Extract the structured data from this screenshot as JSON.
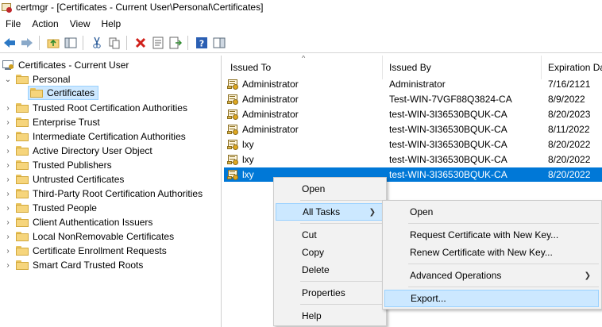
{
  "window": {
    "title": "certmgr - [Certificates - Current User\\Personal\\Certificates]"
  },
  "menu": [
    "File",
    "Action",
    "View",
    "Help"
  ],
  "toolbar": {
    "buttons": [
      "back-icon",
      "forward-icon",
      "up-folder-icon",
      "show-hide-tree-icon",
      "cut-icon",
      "copy-icon",
      "delete-icon",
      "properties-icon",
      "export-list-icon",
      "help-icon",
      "action-pane-icon"
    ]
  },
  "tree": {
    "root": "Certificates - Current User",
    "personal": "Personal",
    "certificates": "Certificates",
    "folders": [
      "Trusted Root Certification Authorities",
      "Enterprise Trust",
      "Intermediate Certification Authorities",
      "Active Directory User Object",
      "Trusted Publishers",
      "Untrusted Certificates",
      "Third-Party Root Certification Authorities",
      "Trusted People",
      "Client Authentication Issuers",
      "Local NonRemovable Certificates",
      "Certificate Enrollment Requests",
      "Smart Card Trusted Roots"
    ]
  },
  "list": {
    "columns": [
      "Issued To",
      "Issued By",
      "Expiration Da"
    ],
    "rows": [
      {
        "issued_to": "Administrator",
        "issued_by": "Administrator",
        "expiration": "7/16/2121"
      },
      {
        "issued_to": "Administrator",
        "issued_by": "Test-WIN-7VGF88Q3824-CA",
        "expiration": "8/9/2022"
      },
      {
        "issued_to": "Administrator",
        "issued_by": "test-WIN-3I36530BQUK-CA",
        "expiration": "8/20/2023"
      },
      {
        "issued_to": "Administrator",
        "issued_by": "test-WIN-3I36530BQUK-CA",
        "expiration": "8/11/2022"
      },
      {
        "issued_to": "lxy",
        "issued_by": "test-WIN-3I36530BQUK-CA",
        "expiration": "8/20/2022"
      },
      {
        "issued_to": "lxy",
        "issued_by": "test-WIN-3I36530BQUK-CA",
        "expiration": "8/20/2022"
      },
      {
        "issued_to": "lxy",
        "issued_by": "test-WIN-3I36530BQUK-CA",
        "expiration": "8/20/2022"
      }
    ],
    "selected_row": 6
  },
  "context_menu": {
    "open": "Open",
    "all_tasks": "All Tasks",
    "cut": "Cut",
    "copy": "Copy",
    "delete": "Delete",
    "properties": "Properties",
    "help": "Help"
  },
  "submenu": {
    "open": "Open",
    "request_new_key": "Request Certificate with New Key...",
    "renew_new_key": "Renew Certificate with New Key...",
    "advanced": "Advanced Operations",
    "export": "Export..."
  },
  "colors": {
    "selection": "#0078d7",
    "menu_highlight": "#cce8ff"
  }
}
